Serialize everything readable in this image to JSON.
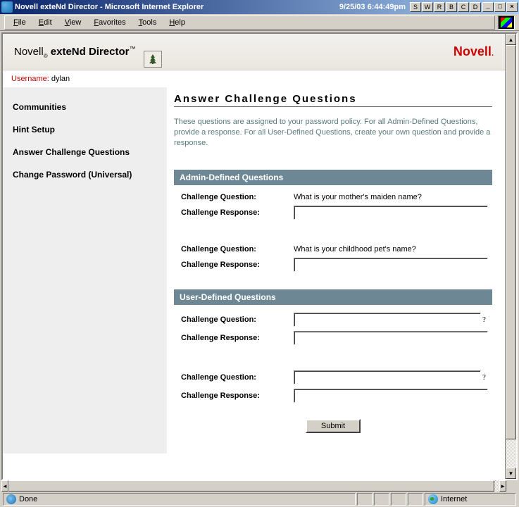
{
  "titlebar": {
    "text": "Novell exteNd Director - Microsoft Internet Explorer",
    "clock": "9/25/03 6:44:49pm",
    "tray_buttons": [
      "S",
      "W",
      "R",
      "B",
      "C",
      "D"
    ],
    "sys_min": "_",
    "sys_max": "□",
    "sys_close": "×"
  },
  "menubar": {
    "items": [
      "File",
      "Edit",
      "View",
      "Favorites",
      "Tools",
      "Help"
    ]
  },
  "brand": {
    "title_a": "Novell",
    "title_b": " exteNd Director",
    "trademark": "™",
    "sub_dot": "®",
    "logo": "Novell",
    "logo_dot": "."
  },
  "userbar": {
    "label": "Username:",
    "value": "dylan"
  },
  "sidebar": {
    "items": [
      {
        "label": "Communities"
      },
      {
        "label": "Hint Setup"
      },
      {
        "label": "Answer Challenge Questions"
      },
      {
        "label": "Change Password (Universal)"
      }
    ]
  },
  "main": {
    "title": "Answer Challenge Questions",
    "intro": "These questions are assigned to your password policy. For all Admin-Defined Questions, provide a response. For all User-Defined Questions, create your own question and provide a response.",
    "admin_header": "Admin-Defined Questions",
    "user_header": "User-Defined Questions",
    "cq_label": "Challenge Question:",
    "cr_label": "Challenge Response:",
    "admin_questions": [
      {
        "question": "What is your mother's maiden name?",
        "response": ""
      },
      {
        "question": "What is your childhood pet's name?",
        "response": ""
      }
    ],
    "user_questions": [
      {
        "question": "",
        "response": ""
      },
      {
        "question": "",
        "response": ""
      }
    ],
    "qmark": "?",
    "submit": "Submit"
  },
  "statusbar": {
    "done": "Done",
    "zone": "Internet"
  },
  "scroll": {
    "up": "▲",
    "down": "▼",
    "left": "◄",
    "right": "►"
  }
}
